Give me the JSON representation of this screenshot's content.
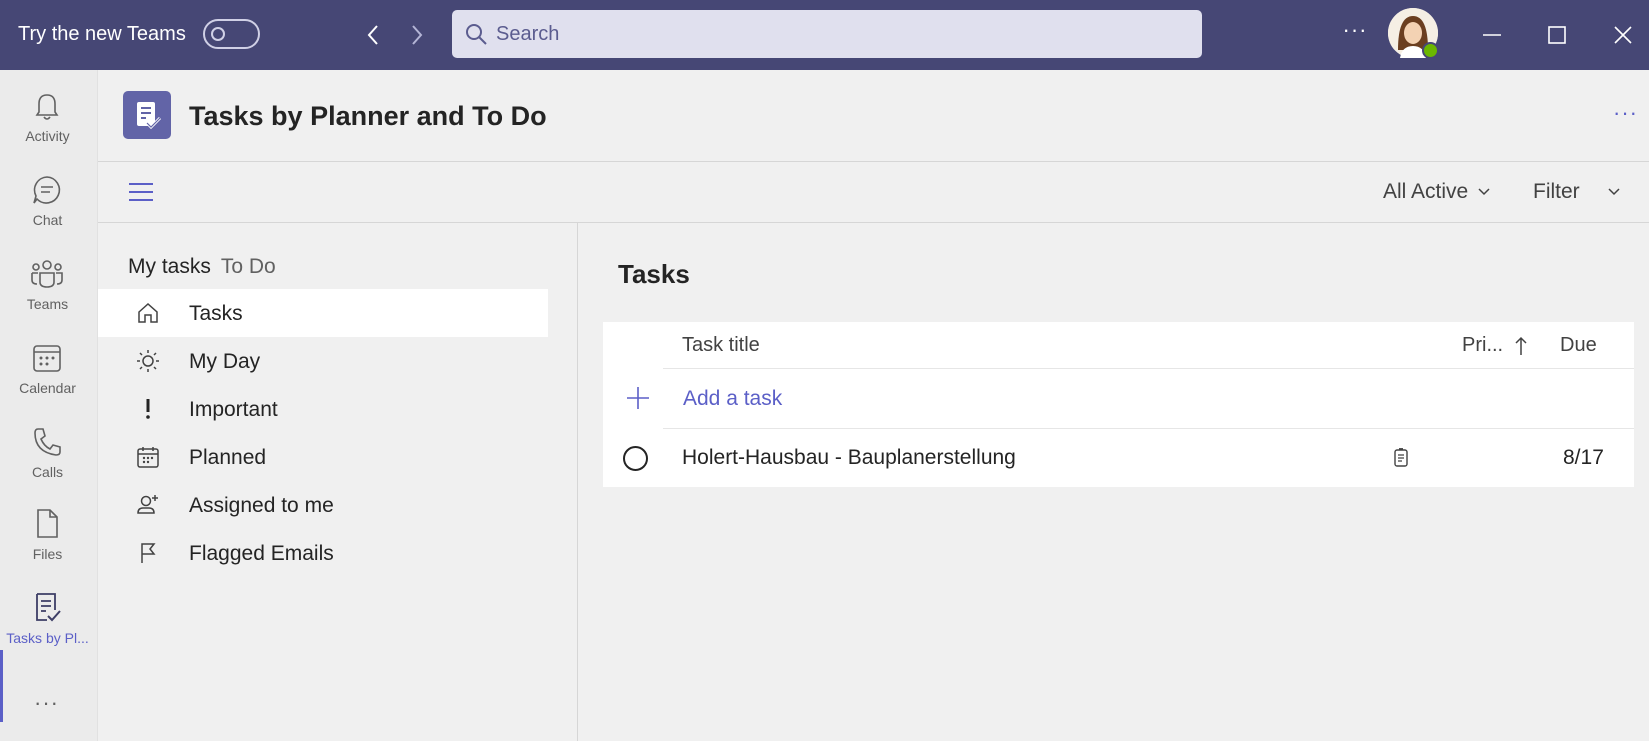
{
  "titlebar": {
    "try_label": "Try the new Teams",
    "toggle_state": "off",
    "search_placeholder": "Search",
    "more_label": "···",
    "back_icon": "chevron-left-icon",
    "forward_icon": "chevron-right-icon"
  },
  "rail": {
    "items": [
      {
        "label": "Activity",
        "icon": "bell-icon"
      },
      {
        "label": "Chat",
        "icon": "chat-icon"
      },
      {
        "label": "Teams",
        "icon": "teams-icon"
      },
      {
        "label": "Calendar",
        "icon": "calendar-icon"
      },
      {
        "label": "Calls",
        "icon": "phone-icon"
      },
      {
        "label": "Files",
        "icon": "file-icon"
      },
      {
        "label": "Tasks by Pl...",
        "icon": "tasks-icon",
        "active": true
      }
    ],
    "more_label": "···"
  },
  "app": {
    "title": "Tasks by Planner and To Do",
    "more_label": "···"
  },
  "toolbar": {
    "view_filter": "All Active",
    "filter_label": "Filter"
  },
  "left_nav": {
    "section_title": "My tasks",
    "section_sub": "To Do",
    "items": [
      {
        "label": "Tasks",
        "icon": "home-icon",
        "selected": true
      },
      {
        "label": "My Day",
        "icon": "sun-icon"
      },
      {
        "label": "Important",
        "icon": "exclamation-icon"
      },
      {
        "label": "Planned",
        "icon": "calendar-grid-icon"
      },
      {
        "label": "Assigned to me",
        "icon": "person-add-icon"
      },
      {
        "label": "Flagged Emails",
        "icon": "flag-icon"
      }
    ]
  },
  "task_pane": {
    "title": "Tasks",
    "columns": {
      "title": "Task title",
      "priority": "Pri...",
      "due": "Due"
    },
    "sort": "priority ascending",
    "add_label": "Add a task",
    "tasks": [
      {
        "title": "Holert-Hausbau - Bauplanerstellung",
        "source_icon": "planner-icon",
        "due": "8/17"
      }
    ]
  },
  "colors": {
    "titlebar": "#464775",
    "accent": "#5b5fc7",
    "app_logo": "#6264a7"
  }
}
